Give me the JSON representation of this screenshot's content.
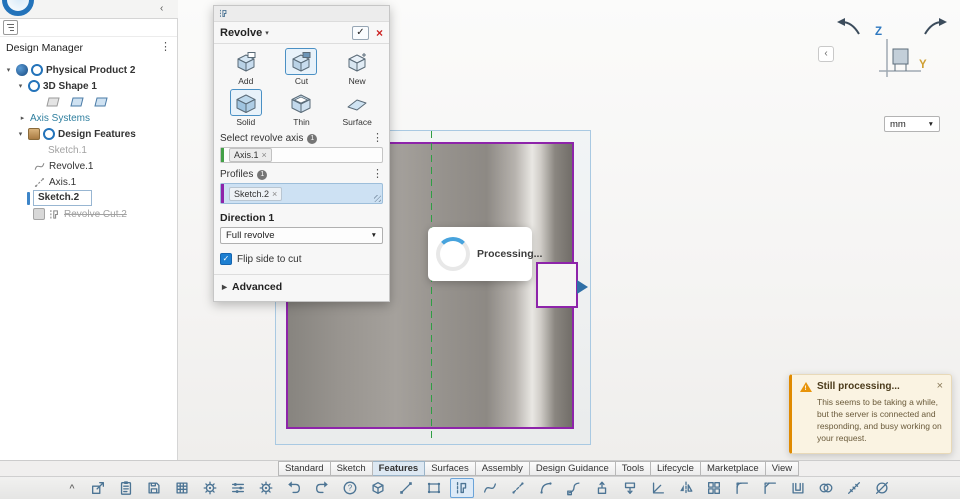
{
  "glyphs": {
    "caret_down": "▾",
    "caret_right": "▸",
    "dots": "⋮",
    "check": "✓",
    "close": "×",
    "chevron_left": "‹",
    "dropdown_caret": "▼",
    "advanced_caret": "▶",
    "toolbar_collapse": "^",
    "warning_mark": "!"
  },
  "tree_panel": {
    "title": "Design Manager",
    "items": [
      {
        "label": "Physical Product 2"
      },
      {
        "label": "3D Shape 1"
      },
      {
        "label": "Axis Systems"
      },
      {
        "label": "Design Features"
      },
      {
        "label": "Sketch.1"
      },
      {
        "label": "Revolve.1"
      },
      {
        "label": "Axis.1"
      },
      {
        "label": "Sketch.2"
      },
      {
        "label": "Revolve Cut.2"
      }
    ]
  },
  "dialog": {
    "title": "Revolve",
    "result_options": [
      {
        "label": "Add",
        "selected": false
      },
      {
        "label": "Cut",
        "selected": true
      },
      {
        "label": "New",
        "selected": false
      }
    ],
    "type_options": [
      {
        "label": "Solid",
        "selected": true
      },
      {
        "label": "Thin",
        "selected": false
      },
      {
        "label": "Surface",
        "selected": false
      }
    ],
    "axis_section": {
      "label": "Select revolve axis",
      "badge": "1",
      "chip": "Axis.1"
    },
    "profiles_section": {
      "label": "Profiles",
      "badge": "1",
      "chip": "Sketch.2"
    },
    "direction_label": "Direction 1",
    "direction_value": "Full revolve",
    "flip_label": "Flip side to cut",
    "flip_checked": true,
    "advanced_label": "Advanced"
  },
  "viewport": {
    "processing_label": "Processing...",
    "axis_z": "Z",
    "axis_y": "Y"
  },
  "units": {
    "value": "mm"
  },
  "notification": {
    "title": "Still processing...",
    "body": "This seems to be taking a while, but the server is connected and responding, and busy working on your request."
  },
  "tabs": {
    "items": [
      "Standard",
      "Sketch",
      "Features",
      "Surfaces",
      "Assembly",
      "Design Guidance",
      "Tools",
      "Lifecycle",
      "Marketplace",
      "View"
    ],
    "active": "Features"
  },
  "toolbar": {
    "icons": [
      {
        "name": "share-icon",
        "sym": "share"
      },
      {
        "name": "clipboard-icon",
        "sym": "clipboard"
      },
      {
        "name": "save-icon",
        "sym": "floppy"
      },
      {
        "name": "drawing-sheet-icon",
        "sym": "sheet"
      },
      {
        "name": "gears-icon",
        "sym": "gear"
      },
      {
        "name": "settings-sliders-icon",
        "sym": "sliders"
      },
      {
        "name": "preferences-gear-icon",
        "sym": "gear"
      },
      {
        "name": "undo-icon",
        "sym": "undo"
      },
      {
        "name": "redo-icon",
        "sym": "redo"
      },
      {
        "name": "help-icon",
        "sym": "question"
      },
      {
        "name": "primitive-box-icon",
        "sym": "cube"
      },
      {
        "name": "line-icon",
        "sym": "line"
      },
      {
        "name": "sketch-profile-icon",
        "sym": "sketch"
      },
      {
        "name": "revolve-tool-icon",
        "sym": "revolve",
        "active": true
      },
      {
        "name": "spline-icon",
        "sym": "spline"
      },
      {
        "name": "axis-line-icon",
        "sym": "axisline"
      },
      {
        "name": "arc-icon",
        "sym": "arc"
      },
      {
        "name": "sweep-icon",
        "sym": "sweep"
      },
      {
        "name": "pad-extrude-icon",
        "sym": "pad"
      },
      {
        "name": "pocket-icon",
        "sym": "pocket"
      },
      {
        "name": "rib-icon",
        "sym": "rib"
      },
      {
        "name": "mirror-icon",
        "sym": "mirror"
      },
      {
        "name": "pattern-grid-icon",
        "sym": "grid"
      },
      {
        "name": "fillet-icon",
        "sym": "fillet"
      },
      {
        "name": "chamfer-icon",
        "sym": "chamfer"
      },
      {
        "name": "shell-icon",
        "sym": "shell"
      },
      {
        "name": "boolean-icon",
        "sym": "boolean"
      },
      {
        "name": "measure-icon",
        "sym": "measure"
      },
      {
        "name": "section-view-icon",
        "sym": "section"
      }
    ]
  }
}
